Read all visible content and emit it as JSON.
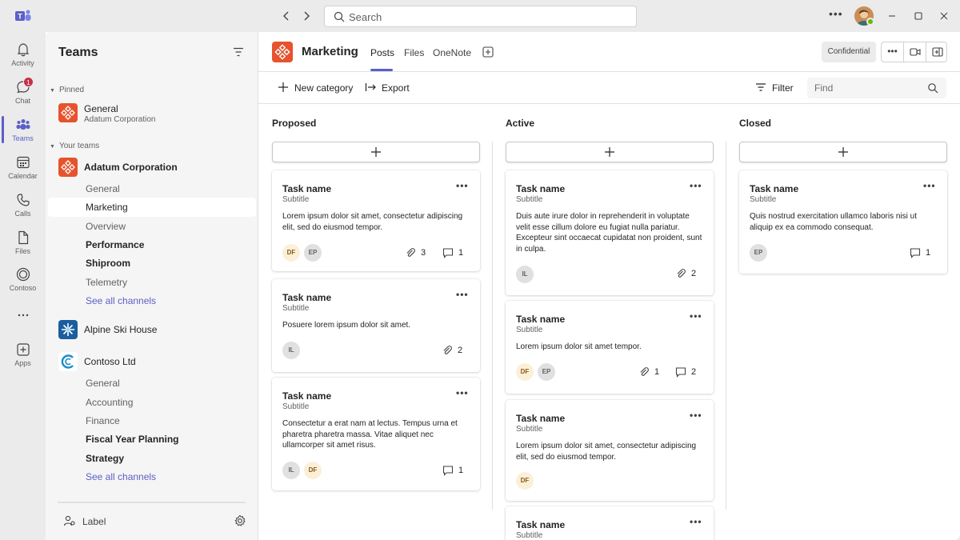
{
  "titlebar": {
    "search_placeholder": "Search",
    "back_icon": "chevron-left-icon",
    "forward_icon": "chevron-right-icon"
  },
  "rail": {
    "items": [
      {
        "label": "Activity",
        "icon": "bell-icon"
      },
      {
        "label": "Chat",
        "icon": "chat-icon",
        "badge": "1"
      },
      {
        "label": "Teams",
        "icon": "teams-icon"
      },
      {
        "label": "Calendar",
        "icon": "calendar-icon"
      },
      {
        "label": "Calls",
        "icon": "phone-icon"
      },
      {
        "label": "Files",
        "icon": "file-icon"
      },
      {
        "label": "Contoso",
        "icon": "contoso-icon"
      },
      {
        "label": "Apps",
        "icon": "add-app-icon"
      }
    ],
    "active": "Teams"
  },
  "left_panel": {
    "title": "Teams",
    "pinned_label": "Pinned",
    "pinned": {
      "name": "General",
      "sub": "Adatum Corporation"
    },
    "your_teams_label": "Your teams",
    "teams": [
      {
        "name": "Adatum Corporation",
        "channels": [
          "General",
          "Marketing",
          "Overview",
          "Performance",
          "Shiproom",
          "Telemetry"
        ],
        "see_all": "See all channels"
      },
      {
        "name": "Alpine Ski House"
      },
      {
        "name": "Contoso Ltd",
        "channels": [
          "General",
          "Accounting",
          "Finance",
          "Fiscal Year Planning",
          "Strategy"
        ],
        "see_all": "See all channels"
      }
    ],
    "footer_label": "Label"
  },
  "header": {
    "channel": "Marketing",
    "tabs": [
      "Posts",
      "Files",
      "OneNote"
    ],
    "active_tab": "Posts",
    "sensitivity": "Confidential"
  },
  "toolbar": {
    "new_category": "New category",
    "export": "Export",
    "filter": "Filter",
    "find_placeholder": "Find"
  },
  "columns": [
    {
      "title": "Proposed",
      "cards": [
        {
          "title": "Task name",
          "subtitle": "Subtitle",
          "body": "Lorem ipsum dolor sit amet, consectetur adipiscing elit, sed do eiusmod tempor.",
          "avatars": [
            "DF",
            "EP"
          ],
          "attachments": "3",
          "comments": "1"
        },
        {
          "title": "Task name",
          "subtitle": "Subtitle",
          "body": "Posuere lorem ipsum dolor sit amet.",
          "avatars": [
            "IL"
          ],
          "attachments": "2"
        },
        {
          "title": "Task name",
          "subtitle": "Subtitle",
          "body": "Consectetur a erat nam at lectus. Tempus urna et pharetra pharetra massa. Vitae aliquet nec ullamcorper sit amet risus.",
          "avatars": [
            "IL",
            "DF"
          ],
          "comments": "1"
        }
      ]
    },
    {
      "title": "Active",
      "cards": [
        {
          "title": "Task name",
          "subtitle": "Subtitle",
          "body": "Duis aute irure dolor in reprehenderit in voluptate velit esse cillum dolore eu fugiat nulla pariatur. Excepteur sint occaecat cupidatat non proident, sunt in culpa.",
          "avatars": [
            "IL"
          ],
          "attachments": "2"
        },
        {
          "title": "Task name",
          "subtitle": "Subtitle",
          "body": "Lorem ipsum dolor sit amet tempor.",
          "avatars": [
            "DF",
            "EP"
          ],
          "attachments": "1",
          "comments": "2"
        },
        {
          "title": "Task name",
          "subtitle": "Subtitle",
          "body": "Lorem ipsum dolor sit amet, consectetur adipiscing elit, sed do eiusmod tempor.",
          "avatars": [
            "DF"
          ]
        },
        {
          "title": "Task name",
          "subtitle": "Subtitle"
        }
      ]
    },
    {
      "title": "Closed",
      "cards": [
        {
          "title": "Task name",
          "subtitle": "Subtitle",
          "body": "Quis nostrud exercitation ullamco laboris nisi ut aliquip ex ea commodo consequat.",
          "avatars": [
            "EP"
          ],
          "comments": "1"
        }
      ]
    }
  ],
  "colors": {
    "accent": "#5b5fc7",
    "team_orange": "#e6532d",
    "badge_red": "#c4314b"
  }
}
